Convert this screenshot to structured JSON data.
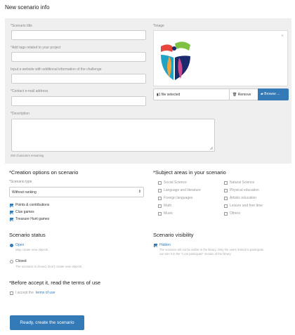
{
  "page": {
    "title": "New scenario info"
  },
  "form": {
    "scenario_title_label": "*Scenario title",
    "tags_label": "*Add tags related to your project",
    "website_label": "Input a website with additional information of the challenge",
    "email_label": "*Contact e-mail address",
    "description_label": "*Description",
    "remaining": "250 characters remaining",
    "image_label": "*Image",
    "image_close": "×",
    "file_selected": "1 file selected",
    "remove_label": "Remove",
    "browse_label": "Browse ..."
  },
  "creation": {
    "title": "*Creation options on scenario",
    "type_label": "*Scenario type",
    "type_value": "Without ranking",
    "options": [
      {
        "label": "Points & contributions",
        "checked": true
      },
      {
        "label": "Clue games",
        "checked": true
      },
      {
        "label": "Treasure Hunt games",
        "checked": true
      }
    ]
  },
  "subjects": {
    "title": "*Subject areas in your scenario",
    "left": [
      "Social Science",
      "Language and literature",
      "Foreign languages",
      "Math",
      "Music"
    ],
    "right": [
      "Natural Science",
      "Physical education",
      "Artistic education",
      "Leisure and free time",
      "Others"
    ]
  },
  "status": {
    "title": "Scenario status",
    "open_label": "Open",
    "open_desc": "May create new objects.",
    "closed_label": "Closed",
    "closed_desc": "The scenario is closed. Don't create new objects."
  },
  "visibility": {
    "title": "Scenario visibility",
    "hidden_label": "Hidden",
    "hidden_desc_1": "The scenario will not be visible in the library. Only the users invited to participate",
    "hidden_desc_2": "can see it in the \"I can participate\" section of the library."
  },
  "terms": {
    "title": "*Before accept it, read the terms of use",
    "accept_prefix": "I accept the",
    "link": "terms of use"
  },
  "submit": {
    "label": "Ready, create the scenario"
  },
  "colors": {
    "accent": "#337ab7",
    "panel": "#efefef"
  }
}
